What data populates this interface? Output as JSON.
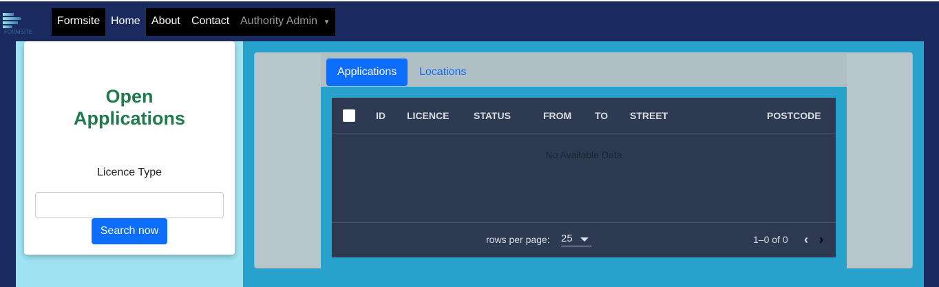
{
  "nav": {
    "logo_text": "FORMSITE",
    "brand": "Formsite",
    "home": "Home",
    "about": "About",
    "contact": "Contact",
    "admin": "Authority Admin"
  },
  "sidebar": {
    "title": "Open Applications",
    "licence_label": "Licence Type",
    "licence_value": "",
    "search_button": "Search now"
  },
  "tabs": [
    {
      "label": "Applications",
      "active": true
    },
    {
      "label": "Locations",
      "active": false
    }
  ],
  "table": {
    "columns": [
      "ID",
      "LICENCE",
      "STATUS",
      "FROM",
      "TO",
      "STREET",
      "POSTCODE"
    ],
    "empty_text": "No Available Data",
    "rows_per_page_label": "rows per page:",
    "rows_per_page": "25",
    "range": "1–0 of 0"
  }
}
